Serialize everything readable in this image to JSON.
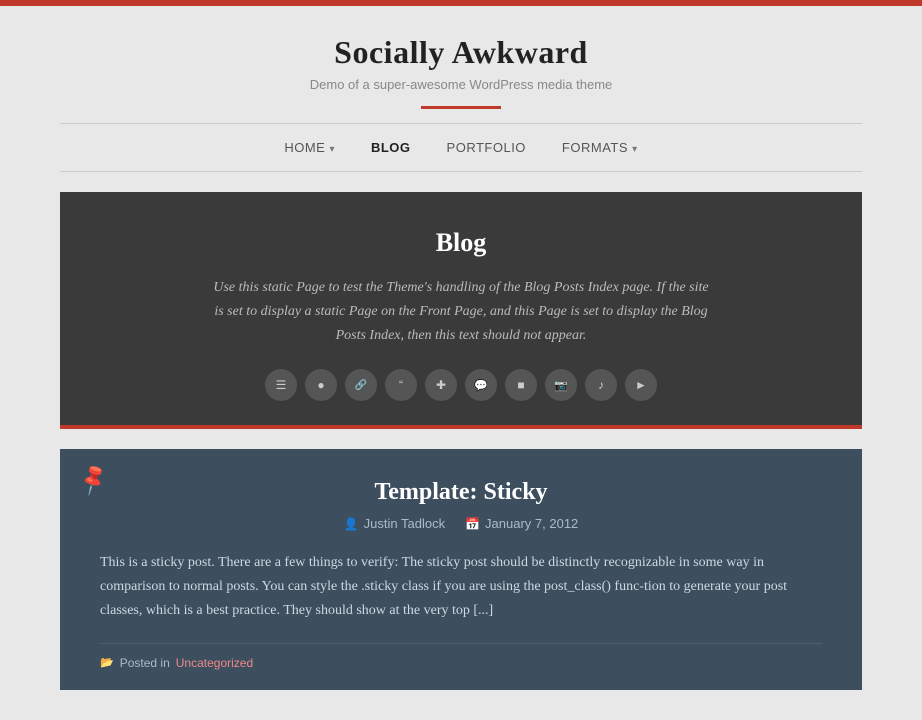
{
  "topBar": {
    "color": "#c0392b"
  },
  "header": {
    "title": "Socially Awkward",
    "tagline": "Demo of a super-awesome WordPress media theme"
  },
  "nav": {
    "items": [
      {
        "label": "HOME",
        "arrow": "▾",
        "active": false
      },
      {
        "label": "BLOG",
        "arrow": "",
        "active": true
      },
      {
        "label": "PORTFOLIO",
        "arrow": "",
        "active": false
      },
      {
        "label": "FORMATS",
        "arrow": "▾",
        "active": false
      }
    ]
  },
  "blogCard": {
    "title": "Blog",
    "description": "Use this static Page to test the Theme's handling of the Blog Posts Index page. If the site is set to display a static Page on the Front Page, and this Page is set to display the Blog Posts Index, then this text should not appear.",
    "icons": [
      {
        "name": "aside-icon",
        "symbol": "☰"
      },
      {
        "name": "status-icon",
        "symbol": "●"
      },
      {
        "name": "link-icon",
        "symbol": "🔗"
      },
      {
        "name": "quote-icon",
        "symbol": "❝"
      },
      {
        "name": "chat-icon",
        "symbol": "✚"
      },
      {
        "name": "comment-icon",
        "symbol": "💬"
      },
      {
        "name": "video-icon",
        "symbol": "▶"
      },
      {
        "name": "image-icon",
        "symbol": "📷"
      },
      {
        "name": "audio-icon",
        "symbol": "♪"
      },
      {
        "name": "gallery-icon",
        "symbol": "▶"
      }
    ]
  },
  "stickyPost": {
    "title": "Template: Sticky",
    "author": "Justin Tadlock",
    "date": "January 7, 2012",
    "excerpt": "This is a sticky post. There are a few things to verify: The sticky post should be distinctly recognizable in some way in comparison to normal posts. You can style the .sticky class if you are using the post_class() func-tion to generate your post classes, which is a best practice. They should show at the very top [...]",
    "category": "Uncategorized",
    "postedIn": "Posted in"
  }
}
